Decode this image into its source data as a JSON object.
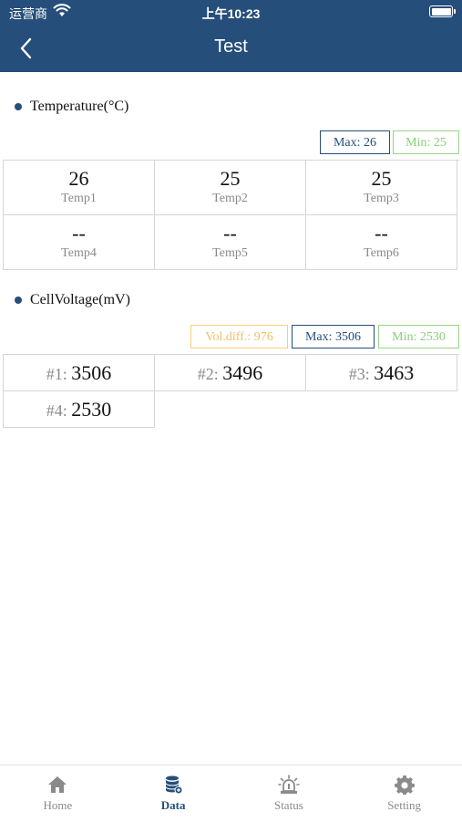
{
  "status_bar": {
    "carrier": "运营商",
    "time": "上午10:23"
  },
  "header": {
    "title": "Test"
  },
  "temperature": {
    "label": "Temperature(°C)",
    "max": "Max: 26",
    "min": "Min: 25",
    "cells": [
      {
        "value": "26",
        "label": "Temp1"
      },
      {
        "value": "25",
        "label": "Temp2"
      },
      {
        "value": "25",
        "label": "Temp3"
      },
      {
        "value": "--",
        "label": "Temp4"
      },
      {
        "value": "--",
        "label": "Temp5"
      },
      {
        "value": "--",
        "label": "Temp6"
      }
    ]
  },
  "voltage": {
    "label": "CellVoltage(mV)",
    "vol_diff": "Vol.diff.: 976",
    "max": "Max: 3506",
    "min": "Min: 2530",
    "cells": [
      {
        "num": "#1: ",
        "value": "3506"
      },
      {
        "num": "#2: ",
        "value": "3496"
      },
      {
        "num": "#3: ",
        "value": "3463"
      },
      {
        "num": "#4: ",
        "value": "2530"
      }
    ]
  },
  "tabbar": {
    "items": [
      {
        "label": "Home",
        "icon": "home-icon"
      },
      {
        "label": "Data",
        "icon": "database-icon"
      },
      {
        "label": "Status",
        "icon": "alarm-icon"
      },
      {
        "label": "Setting",
        "icon": "gear-icon"
      }
    ],
    "active": "Data"
  },
  "colors": {
    "header": "#264e7a",
    "max": "#264e7a",
    "min": "#8bcd77",
    "vol_diff": "#f0c060"
  }
}
